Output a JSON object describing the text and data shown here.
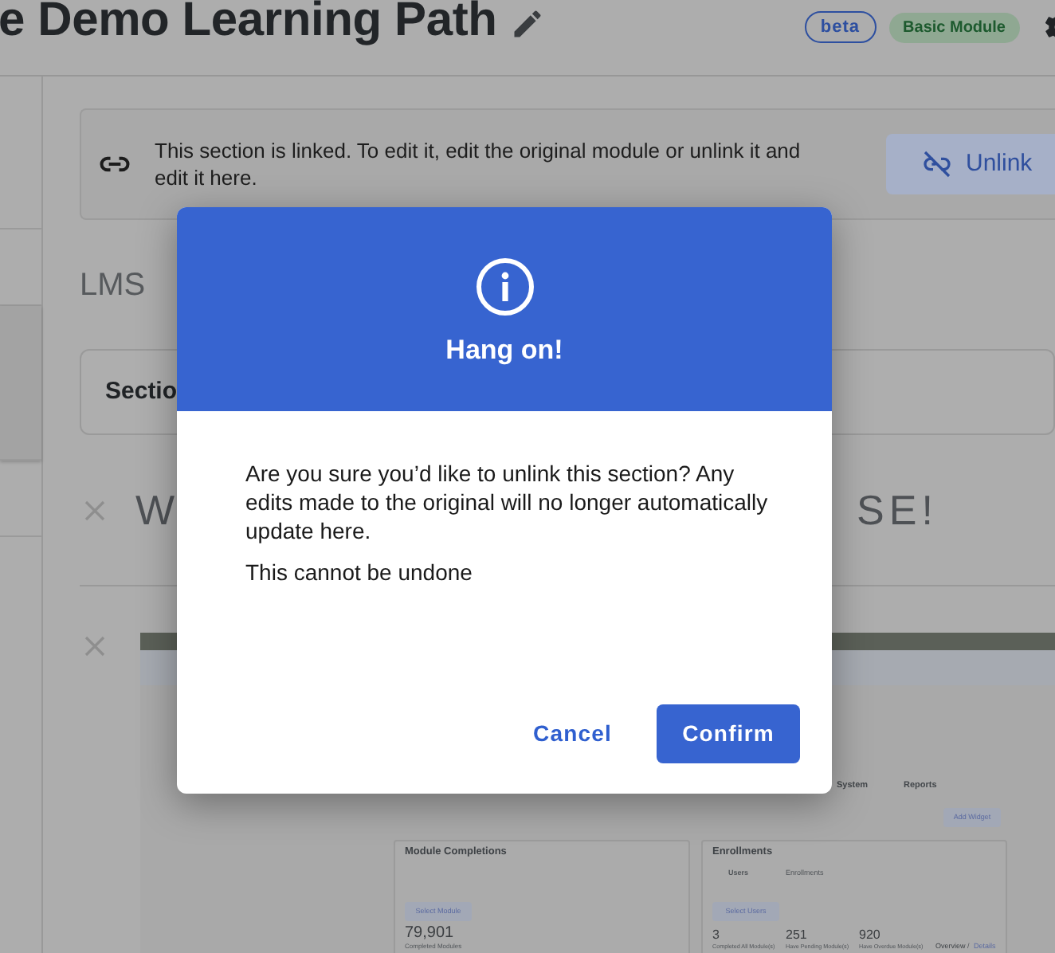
{
  "page": {
    "title": "e Demo Learning Path",
    "badges": [
      {
        "text": "beta",
        "kind": "outline"
      },
      {
        "text": "Basic Module",
        "kind": "filled"
      }
    ]
  },
  "sidebar": {
    "items": [
      {
        "selected": false
      },
      {
        "selected": false
      },
      {
        "selected": true
      },
      {
        "selected": false
      }
    ]
  },
  "linked_banner": {
    "message": "This section is linked. To edit it, edit the original module or unlink it and edit it here.",
    "button": "Unlink"
  },
  "section": {
    "title": "LMS",
    "field_value": "Sectio"
  },
  "text_block": {
    "visible_start": "W",
    "visible_end": "SE!"
  },
  "inner_screenshot": {
    "tabs": [
      "System",
      "Reports"
    ],
    "add_button": "Add Widget",
    "cards": [
      {
        "kind": "completions",
        "title": "Module Completions",
        "button": "Select Module",
        "value": "79,901",
        "caption": "Completed Modules"
      },
      {
        "kind": "enrollments",
        "title": "Enrollments",
        "tabs": [
          "Users",
          "Enrollments"
        ],
        "button": "Select Users",
        "stats": [
          {
            "value": "3",
            "label": "Completed All Module(s)"
          },
          {
            "value": "251",
            "label": "Have Pending Module(s)"
          },
          {
            "value": "920",
            "label": "Have Overdue Module(s)"
          }
        ],
        "links": [
          "Overview",
          "Details"
        ],
        "link_separator": "/"
      }
    ]
  },
  "modal": {
    "title": "Hang on!",
    "message": "Are you sure you’d like to unlink this section? Any edits made to the original will no longer automatically update here.",
    "note": "This cannot be undone",
    "buttons": [
      {
        "text": "Cancel",
        "kind": "link"
      },
      {
        "text": "Confirm",
        "kind": "primary"
      }
    ]
  }
}
